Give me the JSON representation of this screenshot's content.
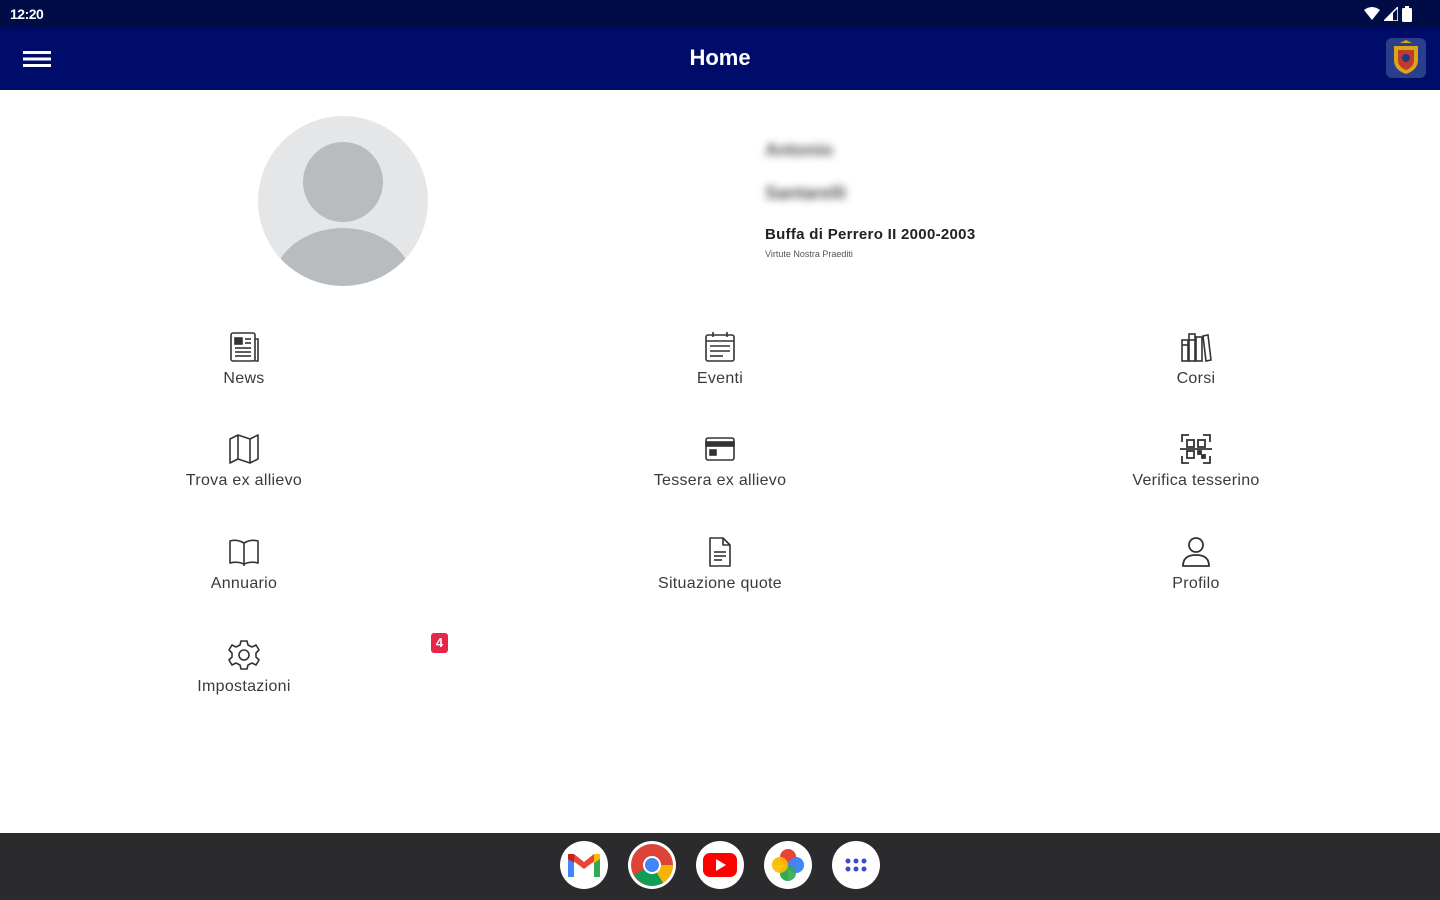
{
  "status": {
    "time": "12:20"
  },
  "appbar": {
    "title": "Home"
  },
  "profile": {
    "first_name": "Antonio",
    "last_name": "Santarelli",
    "class_name": "Buffa di Perrero II 2000-2003",
    "motto": "Virtute Nostra Praediti"
  },
  "menu": [
    {
      "label": "News",
      "icon": "newspaper-icon"
    },
    {
      "label": "Eventi",
      "icon": "calendar-icon"
    },
    {
      "label": "Corsi",
      "icon": "library-icon"
    },
    {
      "label": "Trova ex allievo",
      "icon": "map-icon"
    },
    {
      "label": "Tessera ex allievo",
      "icon": "card-icon"
    },
    {
      "label": "Verifica tesserino",
      "icon": "qr-scan-icon"
    },
    {
      "label": "Annuario",
      "icon": "book-icon"
    },
    {
      "label": "Situazione quote",
      "icon": "document-icon"
    },
    {
      "label": "Profilo",
      "icon": "person-icon"
    },
    {
      "label": "Impostazioni",
      "icon": "gear-icon"
    }
  ],
  "badge": {
    "count": "4"
  },
  "dock": [
    "gmail-icon",
    "chrome-icon",
    "youtube-icon",
    "photos-icon",
    "app-drawer-icon"
  ],
  "colors": {
    "appbar": "#000c6a",
    "statusbar": "#000c45",
    "badge": "#e8264a",
    "navbar": "#2b2b2d"
  }
}
